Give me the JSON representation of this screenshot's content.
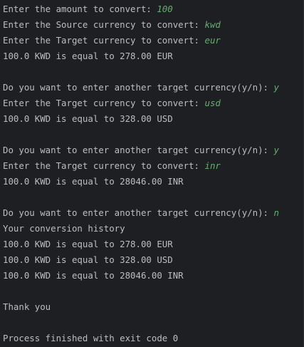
{
  "console": {
    "lines": [
      {
        "text": "Enter the amount to convert: ",
        "input": "100"
      },
      {
        "text": "Enter the Source currency to convert: ",
        "input": "kwd"
      },
      {
        "text": "Enter the Target currency to convert: ",
        "input": "eur"
      },
      {
        "text": "100.0 KWD is equal to 278.00 EUR",
        "input": ""
      },
      {
        "text": "",
        "input": ""
      },
      {
        "text": "Do you want to enter another target currency(y/n): ",
        "input": "y"
      },
      {
        "text": "Enter the Target currency to convert: ",
        "input": "usd"
      },
      {
        "text": "100.0 KWD is equal to 328.00 USD",
        "input": ""
      },
      {
        "text": "",
        "input": ""
      },
      {
        "text": "Do you want to enter another target currency(y/n): ",
        "input": "y"
      },
      {
        "text": "Enter the Target currency to convert: ",
        "input": "inr"
      },
      {
        "text": "100.0 KWD is equal to 28046.00 INR",
        "input": ""
      },
      {
        "text": "",
        "input": ""
      },
      {
        "text": "Do you want to enter another target currency(y/n): ",
        "input": "n"
      },
      {
        "text": "Your conversion history",
        "input": ""
      },
      {
        "text": "100.0 KWD is equal to 278.00 EUR",
        "input": ""
      },
      {
        "text": "100.0 KWD is equal to 328.00 USD",
        "input": ""
      },
      {
        "text": "100.0 KWD is equal to 28046.00 INR",
        "input": ""
      },
      {
        "text": "",
        "input": ""
      },
      {
        "text": "Thank you",
        "input": ""
      },
      {
        "text": "",
        "input": ""
      },
      {
        "text": "Process finished with exit code 0",
        "input": ""
      }
    ]
  },
  "colors": {
    "background": "#1e1f22",
    "output_text": "#bcbec4",
    "user_input": "#6aab73"
  }
}
